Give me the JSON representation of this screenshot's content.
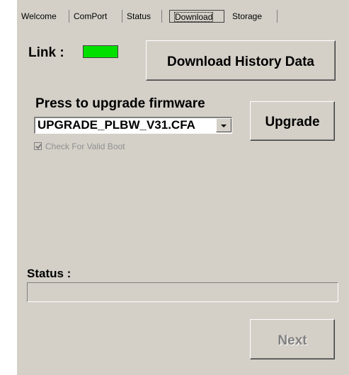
{
  "tabs": [
    {
      "label": "Welcome",
      "active": false
    },
    {
      "label": "ComPort",
      "active": false
    },
    {
      "label": "Status",
      "active": false
    },
    {
      "label": "Download",
      "active": true
    },
    {
      "label": "Storage",
      "active": false
    }
  ],
  "link": {
    "label": "Link :",
    "status_color": "#00e000"
  },
  "download_button": {
    "label": "Download History Data"
  },
  "firmware": {
    "label": "Press to upgrade firmware",
    "selected": "UPGRADE_PLBW_V31.CFA",
    "upgrade_label": "Upgrade"
  },
  "check_valid_boot": {
    "label": "Check For Valid Boot",
    "checked": true,
    "enabled": false
  },
  "status": {
    "label": "Status :",
    "value": ""
  },
  "next_button": {
    "label": "Next",
    "enabled": false
  }
}
